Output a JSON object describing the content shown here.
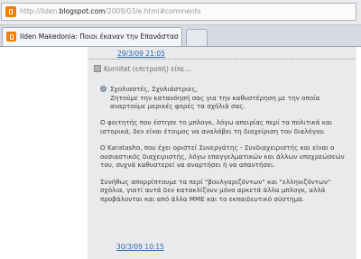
{
  "address_bar": {
    "url_prefix": "http://ilden.",
    "url_domain": "blogspot.com",
    "url_suffix": "/2009/03/e.html#comments",
    "favicon": "blogger-icon"
  },
  "tabs": [
    {
      "title": "Ilden Makedonia: Ποιοι έκαναν την Επανάσταση του 'Ι...",
      "favicon": "blogger-icon",
      "active": true
    }
  ],
  "new_tab_icon": "new-tab-icon",
  "comments": {
    "prev_timestamp": "29/3/09 21:05",
    "author_line": "Kornitet (επιτροπή) είπε...",
    "author_icon": "user-icon",
    "greeting": "Σχολιαστές, Σχολιάστριες,",
    "paragraphs": [
      "Σχολιαστές, Σχολιάστριες,\nΖητούμε την κατανόησή σας για την καθυστέρηση με την οποία αναρτούμε μερικές φορές τα σχόλιά σας.",
      "Ο φοιτητής που έστησε το μπλογκ, λόγω απειρίας περί τα πολιτικά και ιστορικά, δεν είναι έτοιμος να αναλάβει τη διαχείριση του διαλόγου.",
      "Ο Karatasho, που έχει οριστεί Συνεργάτης - Συνδιαχειριστής και είναι ο ουσιαστικός διαχειριστής, λόγω επαγγελματικών και άλλων υποχρεώσεών του, συχνά καθυστερεί να αναρτήσει ή να απαντήσει.",
      "Συνήθως απορρίπτουμε τα περί \"βουλγαριζόντων\" και \"ελληνιζόντων\" σχόλια, γιατί αυτά δεν κατακλίζουν μόνο αρκετά άλλα μπλογκ, αλλά προβάλονται και από άλλα ΜΜΕ και το εκπαιδευτικό σύστημα."
    ],
    "next_timestamp": "30/3/09 10:15"
  },
  "colors": {
    "link": "#2b6bb2",
    "favicon": "#f57d00",
    "comment_bg": "#e9eaeb"
  }
}
